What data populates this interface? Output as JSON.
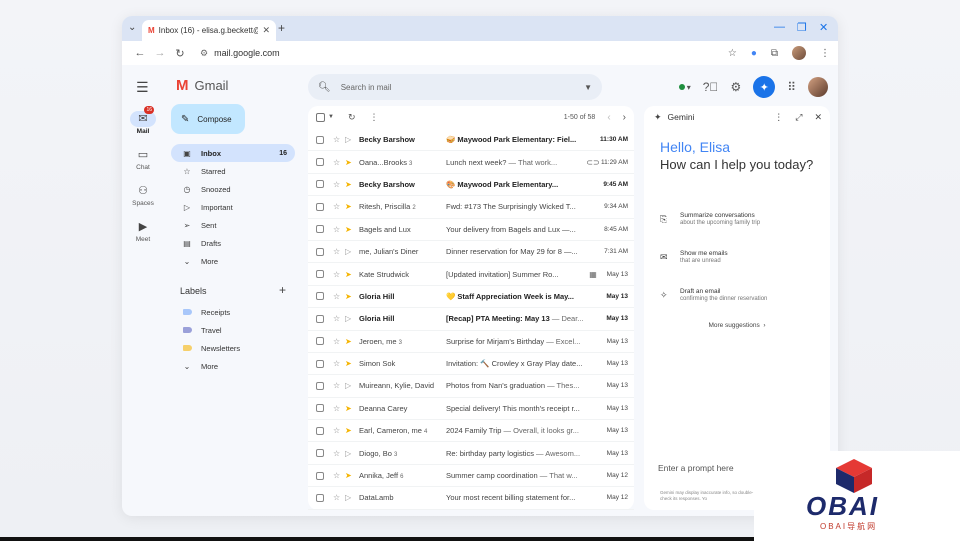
{
  "browser": {
    "tab_title": "Inbox (16) - elisa.g.beckett@",
    "url": "mail.google.com"
  },
  "gmail": {
    "app_name": "Gmail",
    "search_placeholder": "Search in mail",
    "compose_label": "Compose",
    "rail": [
      {
        "label": "Mail",
        "icon": "mail-icon",
        "badge": "16"
      },
      {
        "label": "Chat",
        "icon": "chat-icon"
      },
      {
        "label": "Spaces",
        "icon": "spaces-icon"
      },
      {
        "label": "Meet",
        "icon": "meet-icon"
      }
    ],
    "nav": [
      {
        "label": "Inbox",
        "count": "16",
        "icon": "inbox-icon"
      },
      {
        "label": "Starred",
        "count": "",
        "icon": "star-icon"
      },
      {
        "label": "Snoozed",
        "count": "",
        "icon": "clock-icon"
      },
      {
        "label": "Important",
        "count": "",
        "icon": "important-icon"
      },
      {
        "label": "Sent",
        "count": "",
        "icon": "send-icon"
      },
      {
        "label": "Drafts",
        "count": "",
        "icon": "draft-icon"
      },
      {
        "label": "More",
        "count": "",
        "icon": "chevron-down-icon"
      }
    ],
    "labels_title": "Labels",
    "labels": [
      {
        "label": "Receipts",
        "color": "#a8c7fa"
      },
      {
        "label": "Travel",
        "color": "#9aa0d9"
      },
      {
        "label": "Newsletters",
        "color": "#f6d06b"
      },
      {
        "label": "More",
        "color": ""
      }
    ],
    "pager": "1-50 of 58",
    "emails": [
      {
        "sender": "Becky Barshow",
        "count": "",
        "subject": "🥪 Maywood Park Elementary: Fiel...",
        "snippet": "",
        "date": "11:30 AM",
        "unread": true,
        "important": false,
        "extra": ""
      },
      {
        "sender": "Oana...Brooks",
        "count": "3",
        "subject": "Lunch next week?",
        "snippet": " — That work...",
        "date": "11:29 AM",
        "unread": false,
        "important": true,
        "extra": "⊂⊃"
      },
      {
        "sender": "Becky Barshow",
        "count": "",
        "subject": "🎨 Maywood Park Elementary...",
        "snippet": "",
        "date": "9:45 AM",
        "unread": true,
        "important": true,
        "extra": ""
      },
      {
        "sender": "Ritesh, Priscilla",
        "count": "2",
        "subject": "Fwd: #173 The Surprisingly Wicked T...",
        "snippet": "",
        "date": "9:34 AM",
        "unread": false,
        "important": true,
        "extra": ""
      },
      {
        "sender": "Bagels and Lux",
        "count": "",
        "subject": "Your delivery from Bagels and Lux —...",
        "snippet": "",
        "date": "8:45 AM",
        "unread": false,
        "important": true,
        "extra": ""
      },
      {
        "sender": "me, Julian's Diner",
        "count": "",
        "subject": "Dinner reservation for May 29 for 8 —...",
        "snippet": "",
        "date": "7:31 AM",
        "unread": false,
        "important": false,
        "extra": ""
      },
      {
        "sender": "Kate Strudwick",
        "count": "",
        "subject": "[Updated invitation] Summer Ro...",
        "snippet": "",
        "date": "May 13",
        "unread": false,
        "important": true,
        "extra": "▦"
      },
      {
        "sender": "Gloria Hill",
        "count": "",
        "subject": "💛 Staff Appreciation Week is May...",
        "snippet": "",
        "date": "May 13",
        "unread": true,
        "important": true,
        "extra": ""
      },
      {
        "sender": "Gloria Hill",
        "count": "",
        "subject": "[Recap] PTA Meeting: May 13",
        "snippet": " — Dear...",
        "date": "May 13",
        "unread": true,
        "important": false,
        "extra": ""
      },
      {
        "sender": "Jeroen, me",
        "count": "3",
        "subject": "Surprise for Mirjam's Birthday",
        "snippet": " — Excel...",
        "date": "May 13",
        "unread": false,
        "important": true,
        "extra": ""
      },
      {
        "sender": "Simon Sok",
        "count": "",
        "subject": "Invitation: 🔨 Crowley x Gray Play date...",
        "snippet": "",
        "date": "May 13",
        "unread": false,
        "important": true,
        "extra": ""
      },
      {
        "sender": "Muireann, Kylie, David",
        "count": "",
        "subject": "Photos from Nan's graduation",
        "snippet": " — Thes...",
        "date": "May 13",
        "unread": false,
        "important": false,
        "extra": ""
      },
      {
        "sender": "Deanna Carey",
        "count": "",
        "subject": "Special delivery! This month's receipt r...",
        "snippet": "",
        "date": "May 13",
        "unread": false,
        "important": true,
        "extra": ""
      },
      {
        "sender": "Earl, Cameron, me",
        "count": "4",
        "subject": "2024 Family Trip",
        "snippet": " — Overall, it looks gr...",
        "date": "May 13",
        "unread": false,
        "important": true,
        "extra": ""
      },
      {
        "sender": "Diogo, Bo",
        "count": "3",
        "subject": "Re: birthday party logistics",
        "snippet": " — Awesom...",
        "date": "May 13",
        "unread": false,
        "important": false,
        "extra": ""
      },
      {
        "sender": "Annika, Jeff",
        "count": "6",
        "subject": "Summer camp coordination",
        "snippet": " — That w...",
        "date": "May 12",
        "unread": false,
        "important": true,
        "extra": ""
      },
      {
        "sender": "DataLamb",
        "count": "",
        "subject": "Your most recent billing statement for...",
        "snippet": "",
        "date": "May 12",
        "unread": false,
        "important": false,
        "extra": ""
      }
    ]
  },
  "gemini": {
    "title": "Gemini",
    "hello": "Hello, Elisa",
    "help": "How can I help you today?",
    "suggestions": [
      {
        "title": "Summarize conversations",
        "sub": "about the upcoming family trip",
        "icon": "summarize-icon"
      },
      {
        "title": "Show me emails",
        "sub": "that are unread",
        "icon": "mail-icon"
      },
      {
        "title": "Draft an email",
        "sub": "confirming the dinner reservation",
        "icon": "magic-icon"
      }
    ],
    "more": "More suggestions",
    "prompt_placeholder": "Enter a prompt here",
    "disclaimer": "Gemini may display inaccurate info, so double-check its responses. Yo"
  },
  "watermark": {
    "text": "OBAI",
    "sub": "OBAI导航网"
  }
}
